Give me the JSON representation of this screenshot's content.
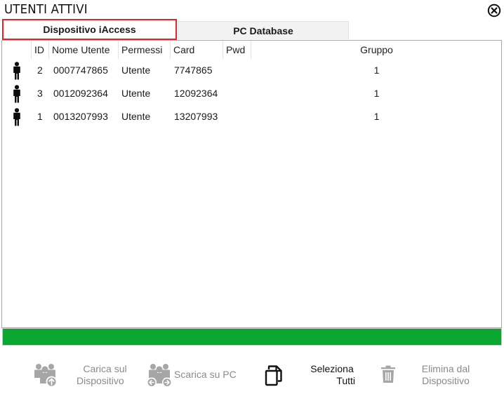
{
  "window": {
    "title": "UTENTI ATTIVI"
  },
  "tabs": [
    {
      "label": "Dispositivo iAccess",
      "active": true
    },
    {
      "label": "PC Database",
      "active": false
    }
  ],
  "table": {
    "headers": [
      "ID",
      "Nome Utente",
      "Permessi",
      "Card",
      "Pwd",
      "Gruppo"
    ],
    "rows": [
      {
        "id": "2",
        "name": "0007747865",
        "perm": "Utente",
        "card": "7747865",
        "pwd": "",
        "group": "1"
      },
      {
        "id": "3",
        "name": "0012092364",
        "perm": "Utente",
        "card": "12092364",
        "pwd": "",
        "group": "1"
      },
      {
        "id": "1",
        "name": "0013207993",
        "perm": "Utente",
        "card": "13207993",
        "pwd": "",
        "group": "1"
      }
    ]
  },
  "progress": {
    "value": 1.0,
    "color": "#0aa830"
  },
  "toolbar": {
    "upload": {
      "line1": "Carica sul",
      "line2": "Dispositivo",
      "icon": "users-upload-icon"
    },
    "download": {
      "label": "Scarica su PC",
      "icon": "users-download-icon"
    },
    "select_all": {
      "line1": "Seleziona",
      "line2": "Tutti",
      "icon": "copy-icon"
    },
    "delete": {
      "line1": "Elimina dal",
      "line2": "Dispositivo",
      "icon": "trash-icon"
    }
  }
}
